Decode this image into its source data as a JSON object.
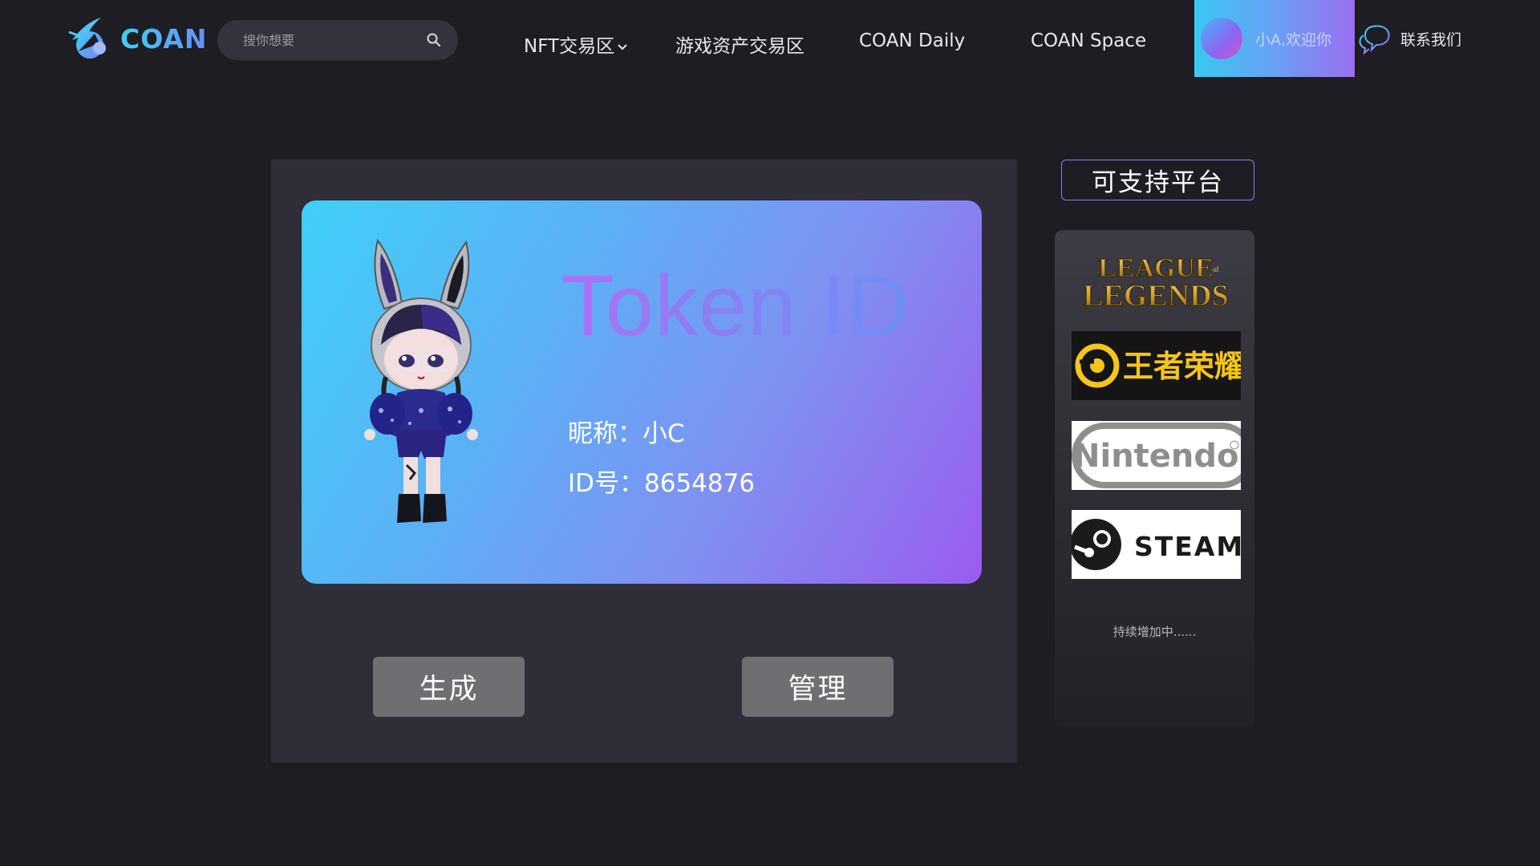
{
  "header": {
    "logo_text": "COAN",
    "search": {
      "placeholder": "搜你想要"
    },
    "nav": [
      {
        "label": "NFT交易区",
        "has_dropdown": true
      },
      {
        "label": "游戏资产交易区"
      },
      {
        "label": "COAN Daily"
      },
      {
        "label": "COAN Space"
      }
    ],
    "user_greeting": "小A,欢迎你",
    "contact_label": "联系我们"
  },
  "card": {
    "title": "Token ID",
    "nickname_line": "昵称：小C",
    "id_line": "ID号：8654876"
  },
  "actions": {
    "generate_label": "生成",
    "manage_label": "管理"
  },
  "sidebar": {
    "title": "可支持平台",
    "platforms": [
      {
        "name": "LEAGUE of LEGENDS",
        "line1": "LEAGUE",
        "of": "of",
        "line2": "LEGENDS"
      },
      {
        "name": "王者荣耀"
      },
      {
        "name": "Nintendo"
      },
      {
        "name": "STEAM"
      }
    ],
    "more_text": "持续增加中......"
  },
  "colors": {
    "background": "#1e1d24",
    "panel": "#2f2d37",
    "accent_cyan": "#3fd0f8",
    "accent_purple": "#9a5cee",
    "button": "#6f6f73"
  }
}
